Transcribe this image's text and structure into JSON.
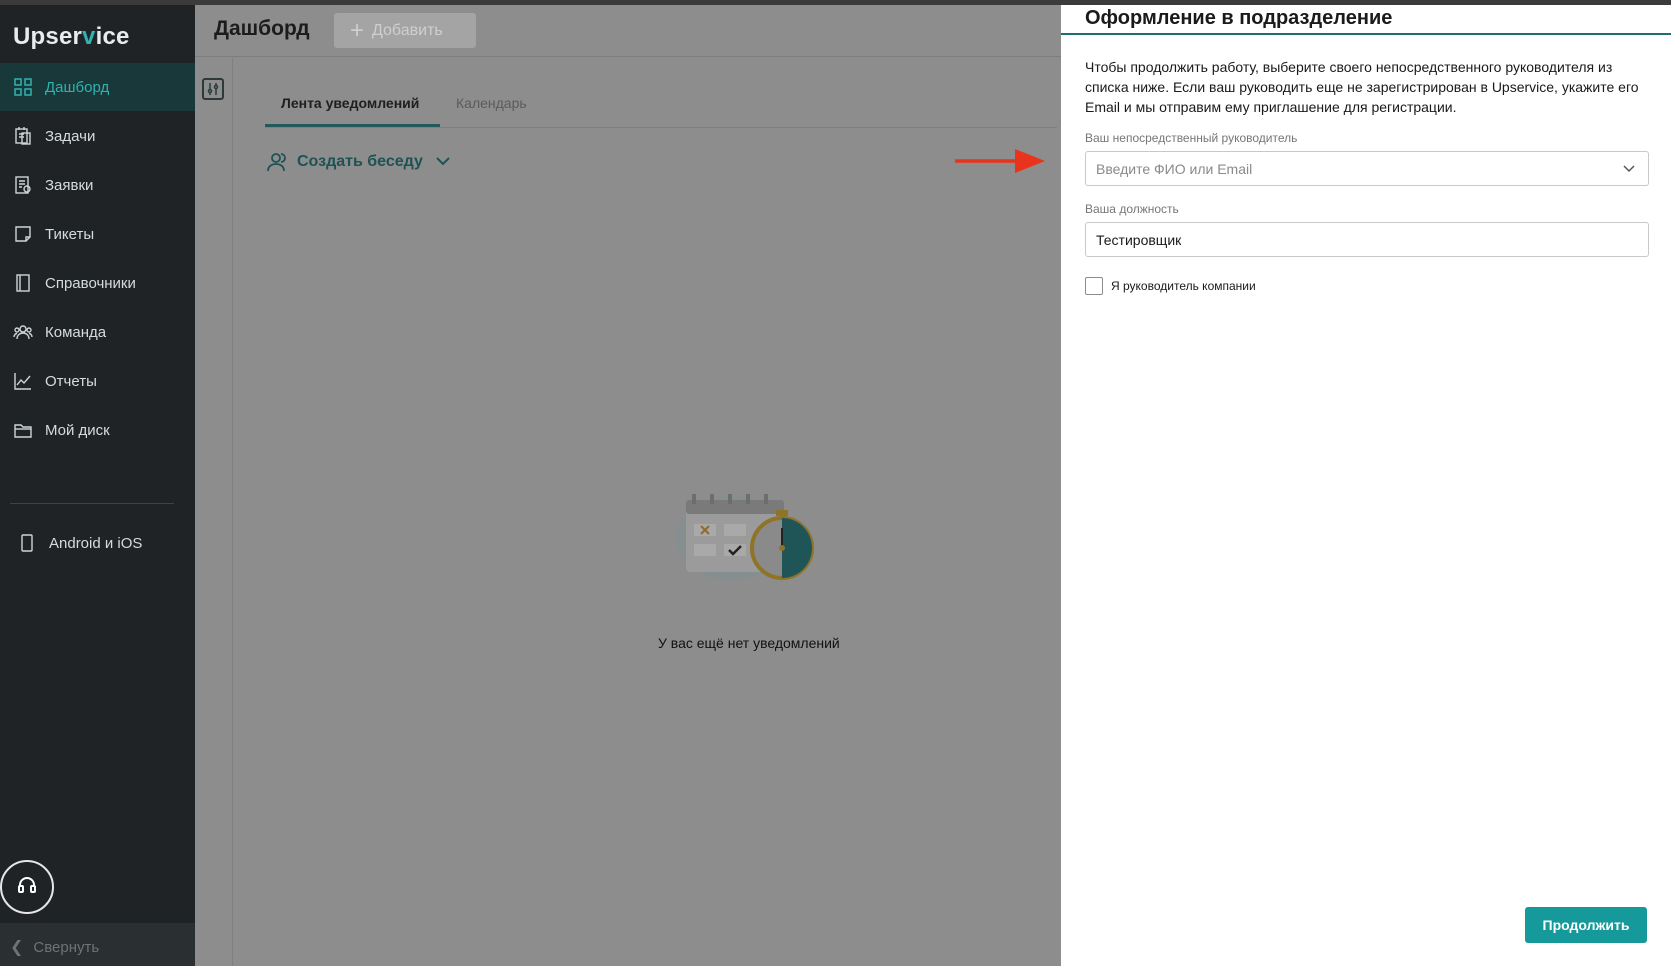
{
  "app": {
    "logo_text_1": "Upser",
    "logo_check": "v",
    "logo_text_2": "ice"
  },
  "sidebar": {
    "items": [
      {
        "label": "Дашборд",
        "icon": "grid-icon",
        "active": true
      },
      {
        "label": "Задачи",
        "icon": "tasks-icon"
      },
      {
        "label": "Заявки",
        "icon": "requests-icon"
      },
      {
        "label": "Тикеты",
        "icon": "ticket-icon"
      },
      {
        "label": "Справочники",
        "icon": "book-icon"
      },
      {
        "label": "Команда",
        "icon": "team-icon"
      },
      {
        "label": "Отчеты",
        "icon": "chart-icon"
      },
      {
        "label": "Мой диск",
        "icon": "folder-icon"
      }
    ],
    "mobile_label": "Android и iOS",
    "collapse_label": "Свернуть",
    "support_icon": "headset-icon"
  },
  "header": {
    "title": "Дашборд",
    "add_label": "Добавить"
  },
  "main": {
    "tabs": [
      {
        "label": "Лента уведомлений",
        "active": true
      },
      {
        "label": "Календарь"
      }
    ],
    "create_chat_label": "Создать беседу",
    "empty_text": "У вас ещё нет уведомлений"
  },
  "panel": {
    "title": "Оформление в подразделение",
    "description": "Чтобы продолжить работу, выберите своего непосредственного руководителя из списка ниже. Если ваш руководить еще не зарегистрирован в Upservice, укажите его Email и мы отправим ему приглашение для регистрации.",
    "manager_label": "Ваш непосредственный руководитель",
    "manager_placeholder": "Введите ФИО или Email",
    "position_label": "Ваша должность",
    "position_value": "Тестировщик",
    "checkbox_label": "Я руководитель компании",
    "checkbox_checked": false,
    "continue_label": "Продолжить"
  },
  "colors": {
    "accent": "#16999b",
    "sidebar_bg": "#1f2326",
    "annotation_arrow": "#e8341c"
  }
}
